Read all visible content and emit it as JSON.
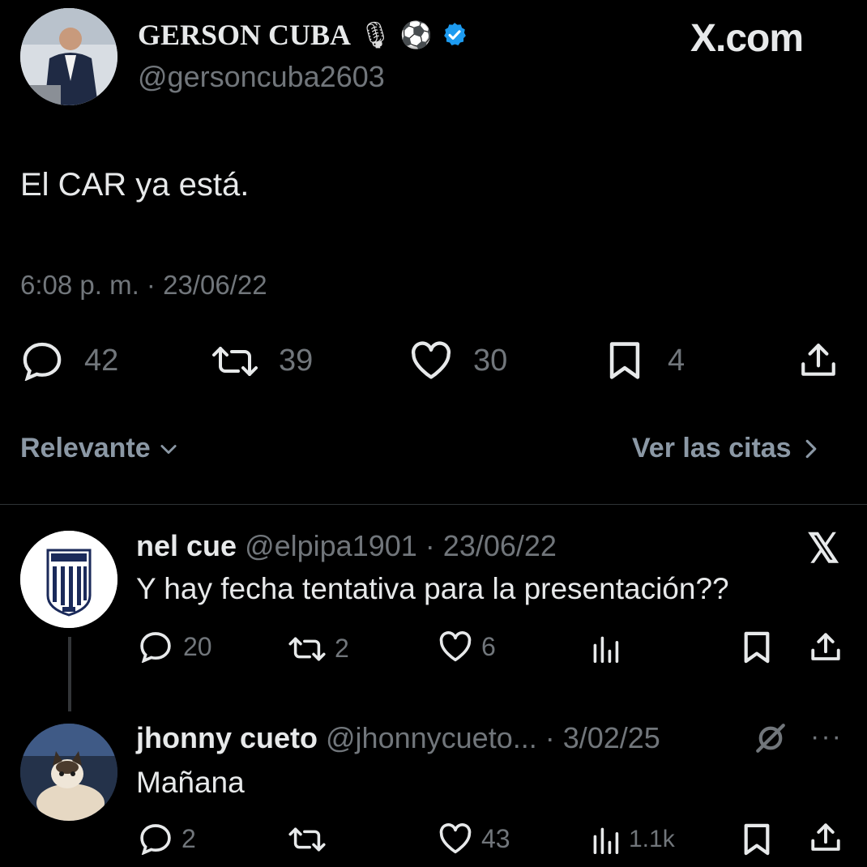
{
  "header": {
    "display_name": "GERSON CUBA",
    "handle": "@gersoncuba2603",
    "badge_emojis": [
      "🎙",
      "⚽"
    ],
    "watermark": "X.com"
  },
  "tweet": {
    "text": "El CAR ya está.",
    "time": "6:08 p. m.",
    "date": "23/06/22",
    "stats": {
      "replies": "42",
      "reposts": "39",
      "likes": "30",
      "bookmarks": "4"
    }
  },
  "filters": {
    "sort_label": "Relevante",
    "quotes_label": "Ver las citas"
  },
  "replies": [
    {
      "name": "nel cue",
      "handle": "@elpipa1901",
      "date": "23/06/22",
      "text": "Y hay fecha tentativa para la presentación??",
      "stats": {
        "replies": "20",
        "reposts": "2",
        "likes": "6",
        "views": ""
      }
    },
    {
      "name": "jhonny cueto",
      "handle": "@jhonnycueto...",
      "date": "3/02/25",
      "text": "Mañana",
      "stats": {
        "replies": "2",
        "reposts": "",
        "likes": "43",
        "views": "1.1k"
      }
    }
  ],
  "colors": {
    "verified": "#1d9bf0",
    "muted": "#71767b",
    "text": "#e7e9ea",
    "background": "#000000"
  }
}
